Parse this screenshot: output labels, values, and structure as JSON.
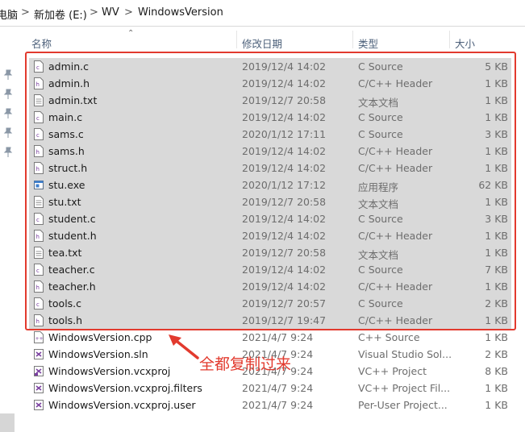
{
  "breadcrumb": [
    "电脑",
    "新加卷 (E:)",
    "WV",
    "WindowsVersion"
  ],
  "breadcrumb_separator": ">",
  "columns": {
    "name": "名称",
    "date": "修改日期",
    "type": "类型",
    "size": "大小"
  },
  "files": [
    {
      "name": "admin.c",
      "date": "2019/12/4 14:02",
      "type": "C Source",
      "size": "5 KB",
      "icon": "c-source-icon",
      "selected": true
    },
    {
      "name": "admin.h",
      "date": "2019/12/4 14:02",
      "type": "C/C++ Header",
      "size": "1 KB",
      "icon": "header-file-icon",
      "selected": true
    },
    {
      "name": "admin.txt",
      "date": "2019/12/7 20:58",
      "type": "文本文档",
      "size": "1 KB",
      "icon": "text-file-icon",
      "selected": true
    },
    {
      "name": "main.c",
      "date": "2019/12/4 14:02",
      "type": "C Source",
      "size": "1 KB",
      "icon": "c-source-icon",
      "selected": true
    },
    {
      "name": "sams.c",
      "date": "2020/1/12 17:11",
      "type": "C Source",
      "size": "3 KB",
      "icon": "c-source-icon",
      "selected": true
    },
    {
      "name": "sams.h",
      "date": "2019/12/4 14:02",
      "type": "C/C++ Header",
      "size": "1 KB",
      "icon": "header-file-icon",
      "selected": true
    },
    {
      "name": "struct.h",
      "date": "2019/12/4 14:02",
      "type": "C/C++ Header",
      "size": "1 KB",
      "icon": "header-file-icon",
      "selected": true
    },
    {
      "name": "stu.exe",
      "date": "2020/1/12 17:12",
      "type": "应用程序",
      "size": "62 KB",
      "icon": "exe-file-icon",
      "selected": true
    },
    {
      "name": "stu.txt",
      "date": "2019/12/7 20:58",
      "type": "文本文档",
      "size": "1 KB",
      "icon": "text-file-icon",
      "selected": true
    },
    {
      "name": "student.c",
      "date": "2019/12/4 14:02",
      "type": "C Source",
      "size": "3 KB",
      "icon": "c-source-icon",
      "selected": true
    },
    {
      "name": "student.h",
      "date": "2019/12/4 14:02",
      "type": "C/C++ Header",
      "size": "1 KB",
      "icon": "header-file-icon",
      "selected": true
    },
    {
      "name": "tea.txt",
      "date": "2019/12/7 20:58",
      "type": "文本文档",
      "size": "1 KB",
      "icon": "text-file-icon",
      "selected": true
    },
    {
      "name": "teacher.c",
      "date": "2019/12/4 14:02",
      "type": "C Source",
      "size": "7 KB",
      "icon": "c-source-icon",
      "selected": true
    },
    {
      "name": "teacher.h",
      "date": "2019/12/4 14:02",
      "type": "C/C++ Header",
      "size": "1 KB",
      "icon": "header-file-icon",
      "selected": true
    },
    {
      "name": "tools.c",
      "date": "2019/12/7 20:57",
      "type": "C Source",
      "size": "2 KB",
      "icon": "c-source-icon",
      "selected": true
    },
    {
      "name": "tools.h",
      "date": "2019/12/7 19:47",
      "type": "C/C++ Header",
      "size": "1 KB",
      "icon": "header-file-icon",
      "selected": true
    },
    {
      "name": "WindowsVersion.cpp",
      "date": "2021/4/7 9:24",
      "type": "C++ Source",
      "size": "1 KB",
      "icon": "cpp-source-icon",
      "selected": false
    },
    {
      "name": "WindowsVersion.sln",
      "date": "2021/4/7 9:24",
      "type": "Visual Studio Sol...",
      "size": "2 KB",
      "icon": "solution-file-icon",
      "selected": false
    },
    {
      "name": "WindowsVersion.vcxproj",
      "date": "2021/4/7 9:24",
      "type": "VC++ Project",
      "size": "8 KB",
      "icon": "vcxproj-file-icon",
      "selected": false
    },
    {
      "name": "WindowsVersion.vcxproj.filters",
      "date": "2021/4/7 9:24",
      "type": "VC++ Project Fil...",
      "size": "1 KB",
      "icon": "filters-file-icon",
      "selected": false
    },
    {
      "name": "WindowsVersion.vcxproj.user",
      "date": "2021/4/7 9:24",
      "type": "Per-User Project...",
      "size": "1 KB",
      "icon": "user-file-icon",
      "selected": false
    }
  ],
  "annotation": {
    "text": "全都复制过来",
    "color": "#e23a2e"
  },
  "colors": {
    "selection": "#d9d9d9",
    "header_text": "#4c607a",
    "meta_text": "#6d6d6d"
  }
}
